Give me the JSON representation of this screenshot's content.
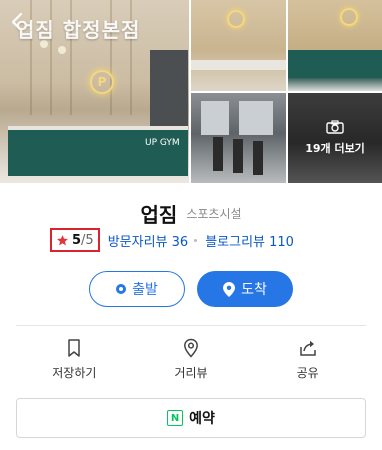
{
  "gallery": {
    "watermark": "업짐 합정본점",
    "main_sign": "UP GYM",
    "logo_letter": "P",
    "more_photos_label": "19개 더보기"
  },
  "place": {
    "name": "업짐",
    "category": "스포츠시설",
    "rating_value": "5",
    "rating_max": "/5",
    "visitor_reviews": "방문자리뷰 36",
    "blog_reviews": "블로그리뷰 110"
  },
  "route": {
    "depart_label": "출발",
    "arrive_label": "도착"
  },
  "actions": [
    {
      "label": "저장하기",
      "icon": "bookmark-icon"
    },
    {
      "label": "거리뷰",
      "icon": "location-pin-icon"
    },
    {
      "label": "공유",
      "icon": "share-icon"
    }
  ],
  "reservation": {
    "icon_letter": "N",
    "label": "예약"
  },
  "colors": {
    "accent": "#2676e6",
    "link": "#0a57c8",
    "rating_highlight": "#d9232e",
    "naver_green": "#03c75a"
  }
}
